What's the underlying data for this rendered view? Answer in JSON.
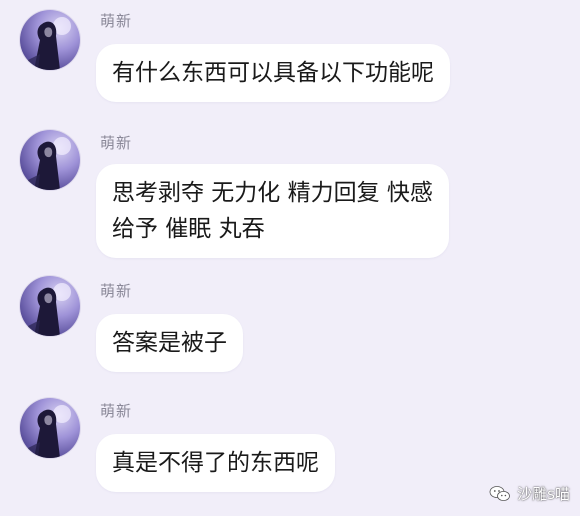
{
  "messages": [
    {
      "sender": "萌新",
      "text": "有什么东西可以具备以下功能呢",
      "avatar_icon": "girl-avatar-icon"
    },
    {
      "sender": "萌新",
      "text": "思考剥夺 无力化 精力回复 快感\n给予 催眠 丸吞",
      "avatar_icon": "girl-avatar-icon"
    },
    {
      "sender": "萌新",
      "text": "答案是被子",
      "avatar_icon": "girl-avatar-icon"
    },
    {
      "sender": "萌新",
      "text": "真是不得了的东西呢",
      "avatar_icon": "girl-avatar-icon"
    }
  ],
  "watermark": {
    "text": "沙雕s喵",
    "icon": "wechat-icon"
  },
  "colors": {
    "background": "#f1eef9",
    "bubble": "#ffffff",
    "sender_name": "#8a8898",
    "message_text": "#1a1a1a"
  }
}
